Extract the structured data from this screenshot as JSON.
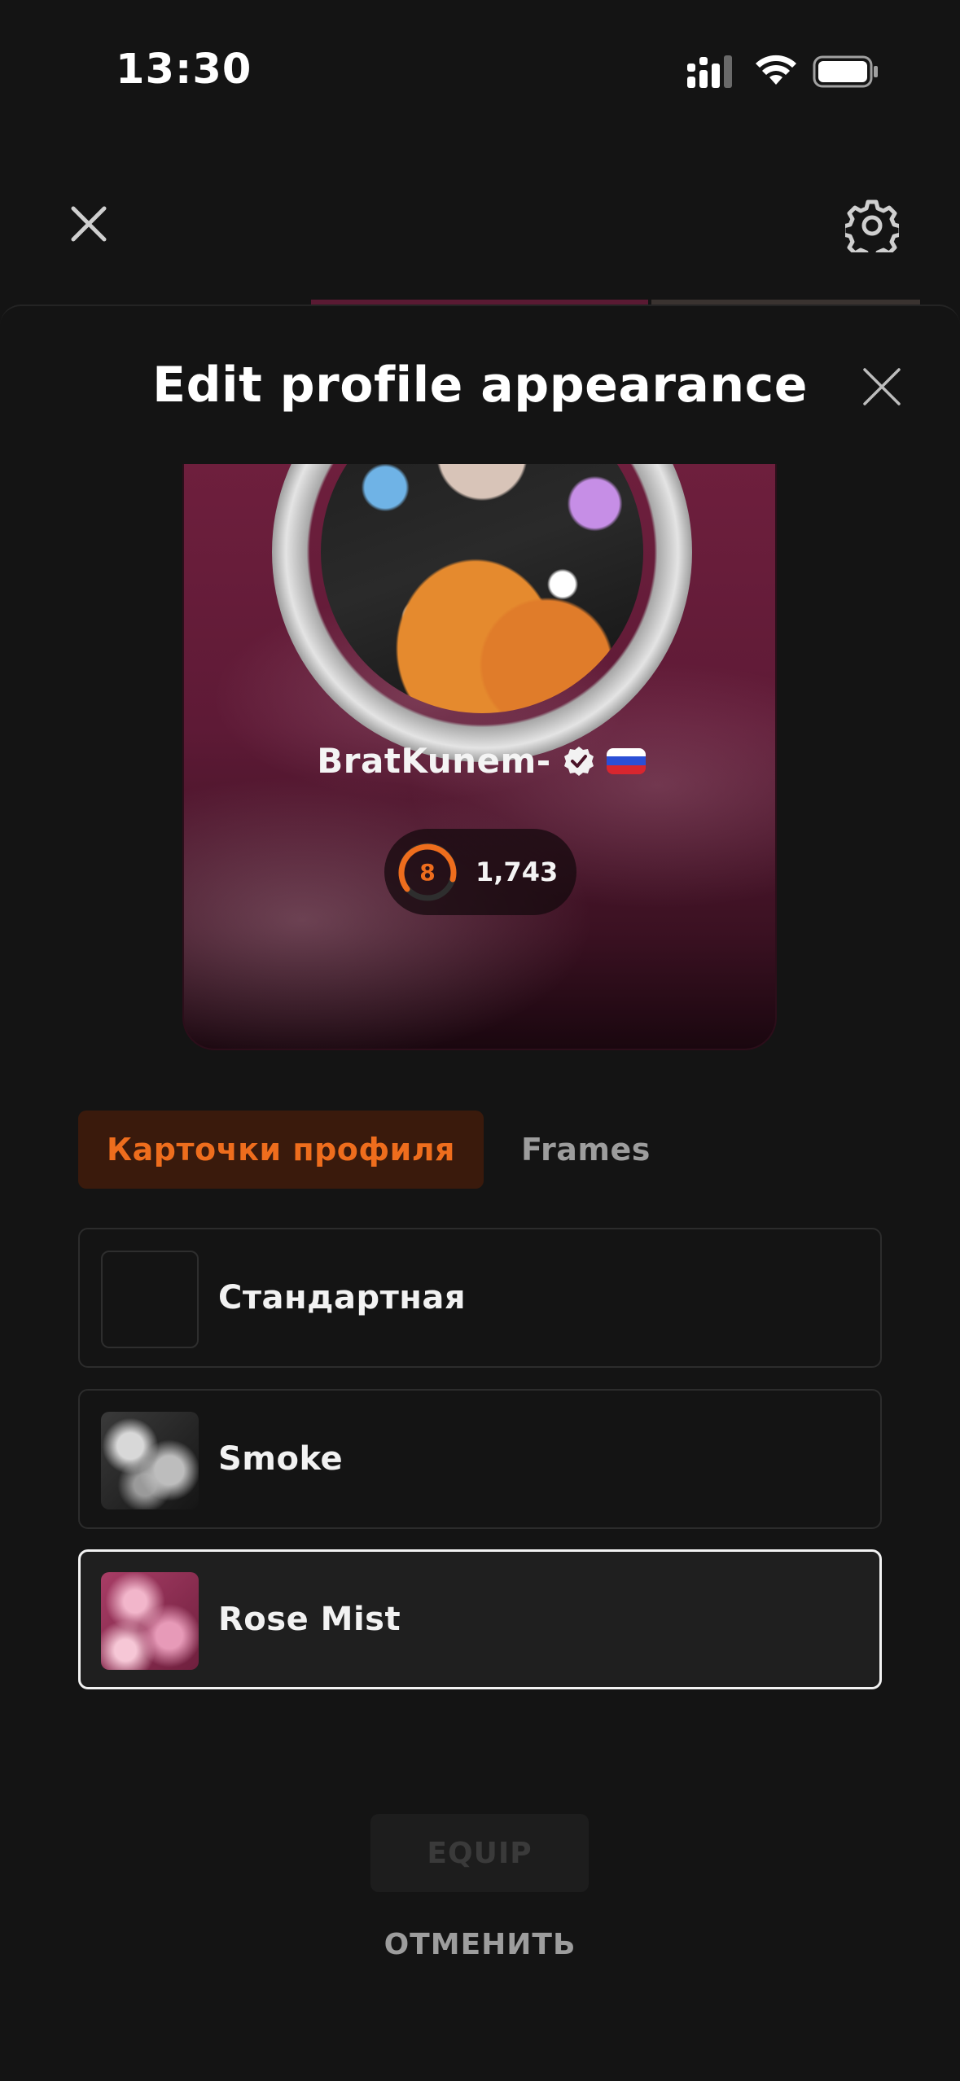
{
  "status_bar": {
    "time": "13:30"
  },
  "sheet": {
    "title": "Edit profile appearance"
  },
  "card": {
    "username": "BratKunem-",
    "level": "8",
    "score": "1,743"
  },
  "tabs": [
    {
      "label": "Карточки профиля",
      "active": true
    },
    {
      "label": "Frames",
      "active": false
    }
  ],
  "options": [
    {
      "label": "Стандартная",
      "selected": false
    },
    {
      "label": "Smoke",
      "selected": false
    },
    {
      "label": "Rose Mist",
      "selected": true
    }
  ],
  "actions": {
    "equip_label": "EQUIP",
    "cancel_label": "ОТМЕНИТЬ"
  },
  "colors": {
    "accent": "#ee6d1d",
    "background": "#141414",
    "card": "#6e1f3d"
  }
}
